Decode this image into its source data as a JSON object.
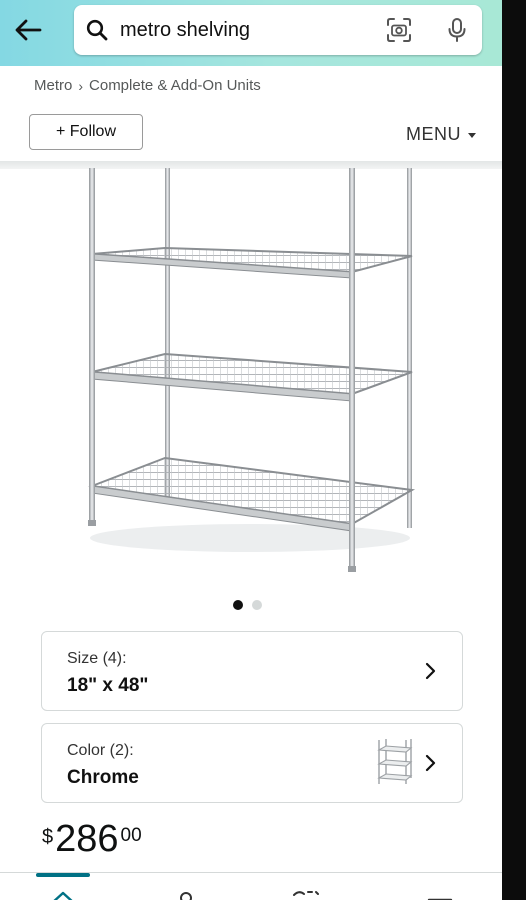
{
  "search": {
    "query": "metro shelving"
  },
  "icons": {
    "back": "back-arrow-icon",
    "search": "search-icon",
    "camera": "camera-icon",
    "mic": "microphone-icon"
  },
  "breadcrumb": {
    "items": [
      "Metro",
      "Complete & Add-On Units"
    ],
    "separator": "›"
  },
  "follow_label": "+ Follow",
  "menu_label": "MENU",
  "carousel": {
    "total": 2,
    "active": 1
  },
  "variations": [
    {
      "label": "Size (4):",
      "value": "18\" x 48\""
    },
    {
      "label": "Color (2):",
      "value": "Chrome"
    }
  ],
  "price": {
    "currency": "$",
    "whole": "286",
    "fraction": "00"
  },
  "colors": {
    "header_start": "#84d8e3",
    "header_end": "#a8e8d6",
    "nav_indicator": "#007185",
    "text_primary": "#0f1111",
    "text_secondary": "#565959"
  }
}
